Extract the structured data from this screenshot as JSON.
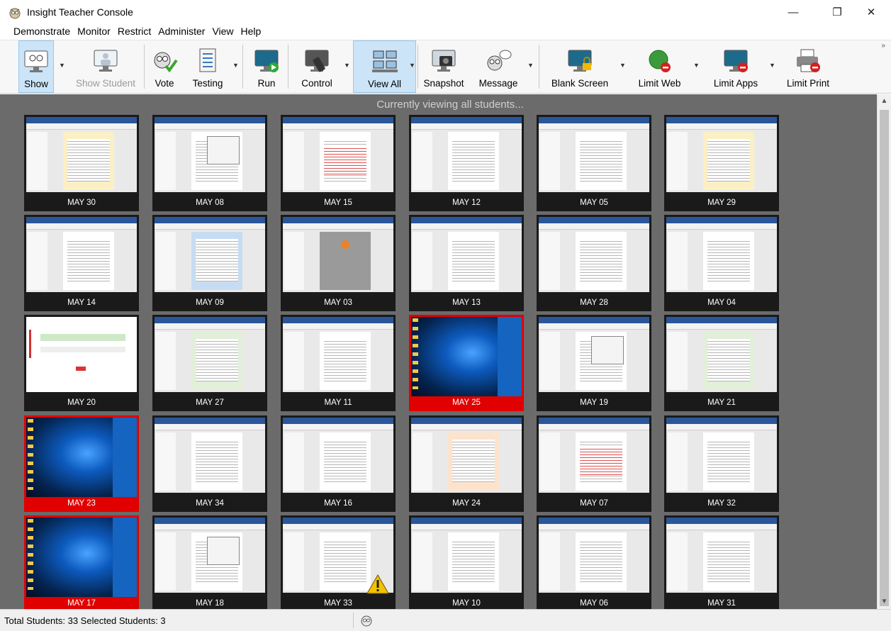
{
  "window": {
    "title": "Insight Teacher Console",
    "controls": {
      "minimize": "—",
      "restore": "❐",
      "close": "✕"
    }
  },
  "menu": [
    "Demonstrate",
    "Monitor",
    "Restrict",
    "Administer",
    "View",
    "Help"
  ],
  "toolbar": {
    "buttons": [
      {
        "label": "Show",
        "icon": "owl-monitor-icon",
        "selected": true,
        "dropdown": true
      },
      {
        "label": "Show Student",
        "icon": "student-monitor-icon",
        "disabled": true
      },
      {
        "label": "Vote",
        "icon": "vote-owl-icon"
      },
      {
        "label": "Testing",
        "icon": "test-sheet-icon",
        "dropdown": true
      },
      {
        "label": "Run",
        "icon": "run-program-icon"
      },
      {
        "label": "Control",
        "icon": "remote-control-icon",
        "dropdown": true
      },
      {
        "label": "View All",
        "icon": "view-all-grid-icon",
        "selected": true,
        "dropdown": true
      },
      {
        "label": "Snapshot",
        "icon": "camera-icon"
      },
      {
        "label": "Message",
        "icon": "message-owl-icon",
        "dropdown": true
      },
      {
        "label": "Blank Screen",
        "icon": "blank-screen-lock-icon",
        "dropdown": true
      },
      {
        "label": "Limit Web",
        "icon": "limit-web-globe-icon",
        "dropdown": true
      },
      {
        "label": "Limit Apps",
        "icon": "limit-apps-icon",
        "dropdown": true
      },
      {
        "label": "Limit Print",
        "icon": "limit-print-icon"
      }
    ],
    "overflow": "»"
  },
  "viewing_caption": "Currently viewing all students...",
  "students": [
    {
      "name": "MAY 30",
      "screen": "doc-yellow"
    },
    {
      "name": "MAY 08",
      "screen": "doc-dialog"
    },
    {
      "name": "MAY 15",
      "screen": "doc-redlines"
    },
    {
      "name": "MAY 12",
      "screen": "doc"
    },
    {
      "name": "MAY 05",
      "screen": "doc"
    },
    {
      "name": "MAY 29",
      "screen": "doc-yellow"
    },
    {
      "name": "MAY 14",
      "screen": "doc"
    },
    {
      "name": "MAY 09",
      "screen": "doc-blue"
    },
    {
      "name": "MAY 03",
      "screen": "doc-cover"
    },
    {
      "name": "MAY 13",
      "screen": "doc"
    },
    {
      "name": "MAY 28",
      "screen": "doc"
    },
    {
      "name": "MAY 04",
      "screen": "doc"
    },
    {
      "name": "MAY 20",
      "screen": "web-form"
    },
    {
      "name": "MAY 27",
      "screen": "doc-green"
    },
    {
      "name": "MAY 11",
      "screen": "doc"
    },
    {
      "name": "MAY 25",
      "screen": "desktop",
      "flagged": true
    },
    {
      "name": "MAY 19",
      "screen": "doc-dialog"
    },
    {
      "name": "MAY 21",
      "screen": "doc-green"
    },
    {
      "name": "MAY 23",
      "screen": "desktop",
      "flagged": true
    },
    {
      "name": "MAY 34",
      "screen": "doc"
    },
    {
      "name": "MAY 16",
      "screen": "doc"
    },
    {
      "name": "MAY 24",
      "screen": "doc-orange"
    },
    {
      "name": "MAY 07",
      "screen": "doc-redlines"
    },
    {
      "name": "MAY 32",
      "screen": "doc"
    },
    {
      "name": "MAY 17",
      "screen": "desktop",
      "flagged": true
    },
    {
      "name": "MAY 18",
      "screen": "doc-dialog"
    },
    {
      "name": "MAY 33",
      "screen": "doc",
      "warning": true
    },
    {
      "name": "MAY 10",
      "screen": "doc"
    },
    {
      "name": "MAY 06",
      "screen": "doc"
    },
    {
      "name": "MAY 31",
      "screen": "doc"
    }
  ],
  "status": {
    "text": "Total Students: 33  Selected Students: 3",
    "icon": "owl-status-icon"
  },
  "colors": {
    "view_background": "#6b6b6b",
    "flagged": "#e00000",
    "selected_button": "#cce4f7",
    "word_titlebar": "#2b579a"
  }
}
